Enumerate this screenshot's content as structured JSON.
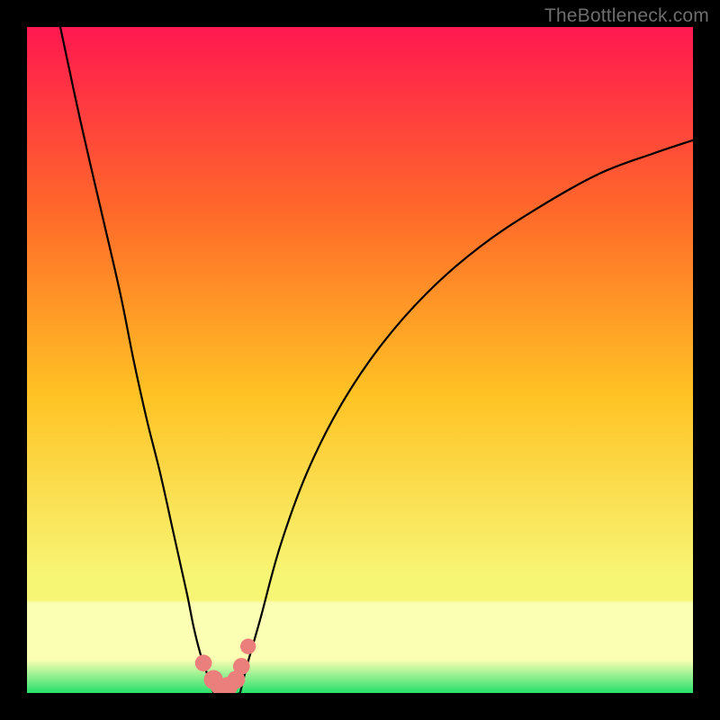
{
  "watermark": "TheBottleneck.com",
  "colors": {
    "frame": "#000000",
    "watermark": "#6d6d6d",
    "gradient_top": "#ff1850",
    "gradient_q1": "#ff6a2a",
    "gradient_mid": "#ffc224",
    "gradient_q3": "#f7f574",
    "gradient_band": "#fbffb3",
    "gradient_bottom": "#27e06b",
    "curve_stroke": "#000000",
    "marker_fill": "#ea7f7c"
  },
  "chart_data": {
    "type": "line",
    "title": "",
    "xlabel": "",
    "ylabel": "",
    "xlim": [
      0,
      100
    ],
    "ylim": [
      0,
      100
    ],
    "series": [
      {
        "name": "left-branch",
        "x": [
          5,
          8,
          11,
          14,
          16,
          18,
          20,
          22,
          24,
          25,
          26,
          27,
          28
        ],
        "y": [
          100,
          86,
          73,
          60,
          50,
          41,
          33,
          24,
          15,
          10,
          6,
          3,
          0
        ]
      },
      {
        "name": "right-branch",
        "x": [
          32,
          33,
          35,
          38,
          42,
          47,
          53,
          60,
          68,
          77,
          86,
          94,
          100
        ],
        "y": [
          0,
          4,
          11,
          22,
          33,
          43,
          52,
          60,
          67,
          73,
          78,
          81,
          83
        ]
      }
    ],
    "trough": {
      "x_start": 28,
      "x_end": 32,
      "y": 0
    },
    "markers": [
      {
        "x": 26.5,
        "y": 4.5,
        "r": 1.4
      },
      {
        "x": 28.0,
        "y": 2.0,
        "r": 1.6
      },
      {
        "x": 28.8,
        "y": 1.0,
        "r": 1.4
      },
      {
        "x": 30.2,
        "y": 1.0,
        "r": 1.6
      },
      {
        "x": 31.4,
        "y": 2.0,
        "r": 1.5
      },
      {
        "x": 32.2,
        "y": 4.0,
        "r": 1.4
      },
      {
        "x": 33.2,
        "y": 7.0,
        "r": 1.3
      }
    ]
  }
}
